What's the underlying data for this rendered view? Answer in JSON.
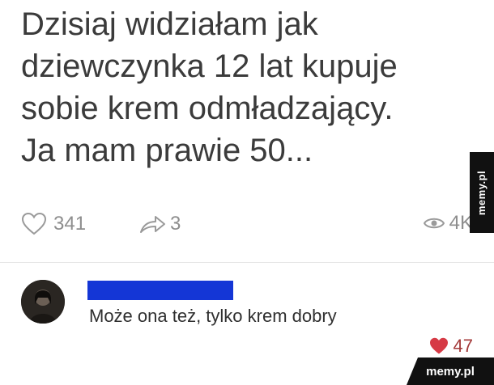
{
  "post": {
    "lines": [
      "Dzisiaj widziałam jak",
      "dziewczynka 12 lat kupuje",
      "sobie krem odmładzający.",
      "Ja mam prawie 50..."
    ],
    "likes": "341",
    "shares": "3",
    "views": "4K"
  },
  "comment": {
    "text": "Może ona też, tylko krem dobry",
    "likes": "47",
    "redaction_color": "#1436d6"
  },
  "watermark": {
    "side": "memy.pl",
    "corner": "memy.pl"
  },
  "icons": {
    "like": "heart-outline-icon",
    "share": "share-arrow-icon",
    "views": "eye-icon",
    "comment_like": "heart-filled-icon"
  },
  "colors": {
    "heart_filled": "#d63a45",
    "stats_gray": "#8e8e8e"
  }
}
